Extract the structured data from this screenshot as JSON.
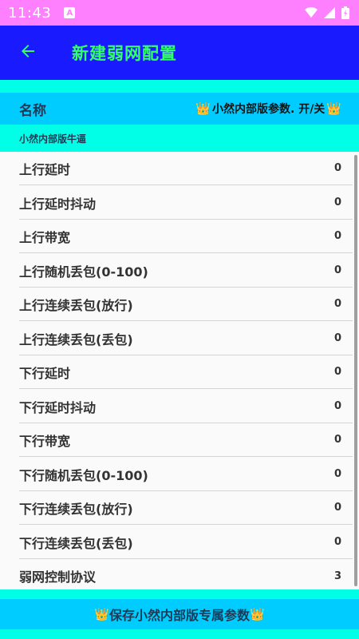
{
  "status_bar": {
    "time": "11:43",
    "notification_badge": "A",
    "icons": [
      "wifi-icon",
      "signal-icon",
      "battery-icon"
    ]
  },
  "app_bar": {
    "title": "新建弱网配置",
    "back_icon": "arrow-left-icon",
    "background": "#1a1aff",
    "title_color": "#33ff66"
  },
  "name_row": {
    "label": "名称",
    "toggle_text": "小然内部版参数. 开/关",
    "crown_glyph": "👑"
  },
  "section": {
    "header": "小然内部版牛逼"
  },
  "items": [
    {
      "label": "上行延时",
      "value": "0"
    },
    {
      "label": "上行延时抖动",
      "value": "0"
    },
    {
      "label": "上行带宽",
      "value": "0"
    },
    {
      "label": "上行随机丢包(0-100)",
      "value": "0"
    },
    {
      "label": "上行连续丢包(放行)",
      "value": "0"
    },
    {
      "label": "上行连续丢包(丢包)",
      "value": "0"
    },
    {
      "label": "下行延时",
      "value": "0"
    },
    {
      "label": "下行延时抖动",
      "value": "0"
    },
    {
      "label": "下行带宽",
      "value": "0"
    },
    {
      "label": "下行随机丢包(0-100)",
      "value": "0"
    },
    {
      "label": "下行连续丢包(放行)",
      "value": "0"
    },
    {
      "label": "下行连续丢包(丢包)",
      "value": "0"
    },
    {
      "label": "弱网控制协议",
      "value": "3"
    }
  ],
  "save_button": {
    "label": "保存小然内部版专属参数",
    "crown_glyph": "👑"
  },
  "colors": {
    "status_bar": "#ff80ff",
    "cyan_accent": "#00ffe6",
    "sky_blue": "#00ccff",
    "crown": "#f4b400"
  }
}
